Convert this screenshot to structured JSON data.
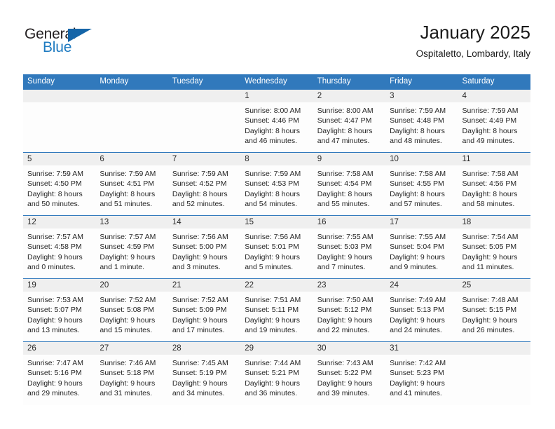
{
  "brand": {
    "name_part1": "General",
    "name_part2": "Blue",
    "accent_color": "#1f7bc1",
    "triangle_color": "#1565a8"
  },
  "header": {
    "title": "January 2025",
    "location": "Ospitaletto, Lombardy, Italy"
  },
  "theme": {
    "header_bg": "#3179bc",
    "daynum_bg": "#efefef",
    "row_border": "#3179bc"
  },
  "weekdays": [
    "Sunday",
    "Monday",
    "Tuesday",
    "Wednesday",
    "Thursday",
    "Friday",
    "Saturday"
  ],
  "weeks": [
    [
      {
        "day": "",
        "l1": "",
        "l2": "",
        "l3": "",
        "l4": ""
      },
      {
        "day": "",
        "l1": "",
        "l2": "",
        "l3": "",
        "l4": ""
      },
      {
        "day": "",
        "l1": "",
        "l2": "",
        "l3": "",
        "l4": ""
      },
      {
        "day": "1",
        "l1": "Sunrise: 8:00 AM",
        "l2": "Sunset: 4:46 PM",
        "l3": "Daylight: 8 hours",
        "l4": "and 46 minutes."
      },
      {
        "day": "2",
        "l1": "Sunrise: 8:00 AM",
        "l2": "Sunset: 4:47 PM",
        "l3": "Daylight: 8 hours",
        "l4": "and 47 minutes."
      },
      {
        "day": "3",
        "l1": "Sunrise: 7:59 AM",
        "l2": "Sunset: 4:48 PM",
        "l3": "Daylight: 8 hours",
        "l4": "and 48 minutes."
      },
      {
        "day": "4",
        "l1": "Sunrise: 7:59 AM",
        "l2": "Sunset: 4:49 PM",
        "l3": "Daylight: 8 hours",
        "l4": "and 49 minutes."
      }
    ],
    [
      {
        "day": "5",
        "l1": "Sunrise: 7:59 AM",
        "l2": "Sunset: 4:50 PM",
        "l3": "Daylight: 8 hours",
        "l4": "and 50 minutes."
      },
      {
        "day": "6",
        "l1": "Sunrise: 7:59 AM",
        "l2": "Sunset: 4:51 PM",
        "l3": "Daylight: 8 hours",
        "l4": "and 51 minutes."
      },
      {
        "day": "7",
        "l1": "Sunrise: 7:59 AM",
        "l2": "Sunset: 4:52 PM",
        "l3": "Daylight: 8 hours",
        "l4": "and 52 minutes."
      },
      {
        "day": "8",
        "l1": "Sunrise: 7:59 AM",
        "l2": "Sunset: 4:53 PM",
        "l3": "Daylight: 8 hours",
        "l4": "and 54 minutes."
      },
      {
        "day": "9",
        "l1": "Sunrise: 7:58 AM",
        "l2": "Sunset: 4:54 PM",
        "l3": "Daylight: 8 hours",
        "l4": "and 55 minutes."
      },
      {
        "day": "10",
        "l1": "Sunrise: 7:58 AM",
        "l2": "Sunset: 4:55 PM",
        "l3": "Daylight: 8 hours",
        "l4": "and 57 minutes."
      },
      {
        "day": "11",
        "l1": "Sunrise: 7:58 AM",
        "l2": "Sunset: 4:56 PM",
        "l3": "Daylight: 8 hours",
        "l4": "and 58 minutes."
      }
    ],
    [
      {
        "day": "12",
        "l1": "Sunrise: 7:57 AM",
        "l2": "Sunset: 4:58 PM",
        "l3": "Daylight: 9 hours",
        "l4": "and 0 minutes."
      },
      {
        "day": "13",
        "l1": "Sunrise: 7:57 AM",
        "l2": "Sunset: 4:59 PM",
        "l3": "Daylight: 9 hours",
        "l4": "and 1 minute."
      },
      {
        "day": "14",
        "l1": "Sunrise: 7:56 AM",
        "l2": "Sunset: 5:00 PM",
        "l3": "Daylight: 9 hours",
        "l4": "and 3 minutes."
      },
      {
        "day": "15",
        "l1": "Sunrise: 7:56 AM",
        "l2": "Sunset: 5:01 PM",
        "l3": "Daylight: 9 hours",
        "l4": "and 5 minutes."
      },
      {
        "day": "16",
        "l1": "Sunrise: 7:55 AM",
        "l2": "Sunset: 5:03 PM",
        "l3": "Daylight: 9 hours",
        "l4": "and 7 minutes."
      },
      {
        "day": "17",
        "l1": "Sunrise: 7:55 AM",
        "l2": "Sunset: 5:04 PM",
        "l3": "Daylight: 9 hours",
        "l4": "and 9 minutes."
      },
      {
        "day": "18",
        "l1": "Sunrise: 7:54 AM",
        "l2": "Sunset: 5:05 PM",
        "l3": "Daylight: 9 hours",
        "l4": "and 11 minutes."
      }
    ],
    [
      {
        "day": "19",
        "l1": "Sunrise: 7:53 AM",
        "l2": "Sunset: 5:07 PM",
        "l3": "Daylight: 9 hours",
        "l4": "and 13 minutes."
      },
      {
        "day": "20",
        "l1": "Sunrise: 7:52 AM",
        "l2": "Sunset: 5:08 PM",
        "l3": "Daylight: 9 hours",
        "l4": "and 15 minutes."
      },
      {
        "day": "21",
        "l1": "Sunrise: 7:52 AM",
        "l2": "Sunset: 5:09 PM",
        "l3": "Daylight: 9 hours",
        "l4": "and 17 minutes."
      },
      {
        "day": "22",
        "l1": "Sunrise: 7:51 AM",
        "l2": "Sunset: 5:11 PM",
        "l3": "Daylight: 9 hours",
        "l4": "and 19 minutes."
      },
      {
        "day": "23",
        "l1": "Sunrise: 7:50 AM",
        "l2": "Sunset: 5:12 PM",
        "l3": "Daylight: 9 hours",
        "l4": "and 22 minutes."
      },
      {
        "day": "24",
        "l1": "Sunrise: 7:49 AM",
        "l2": "Sunset: 5:13 PM",
        "l3": "Daylight: 9 hours",
        "l4": "and 24 minutes."
      },
      {
        "day": "25",
        "l1": "Sunrise: 7:48 AM",
        "l2": "Sunset: 5:15 PM",
        "l3": "Daylight: 9 hours",
        "l4": "and 26 minutes."
      }
    ],
    [
      {
        "day": "26",
        "l1": "Sunrise: 7:47 AM",
        "l2": "Sunset: 5:16 PM",
        "l3": "Daylight: 9 hours",
        "l4": "and 29 minutes."
      },
      {
        "day": "27",
        "l1": "Sunrise: 7:46 AM",
        "l2": "Sunset: 5:18 PM",
        "l3": "Daylight: 9 hours",
        "l4": "and 31 minutes."
      },
      {
        "day": "28",
        "l1": "Sunrise: 7:45 AM",
        "l2": "Sunset: 5:19 PM",
        "l3": "Daylight: 9 hours",
        "l4": "and 34 minutes."
      },
      {
        "day": "29",
        "l1": "Sunrise: 7:44 AM",
        "l2": "Sunset: 5:21 PM",
        "l3": "Daylight: 9 hours",
        "l4": "and 36 minutes."
      },
      {
        "day": "30",
        "l1": "Sunrise: 7:43 AM",
        "l2": "Sunset: 5:22 PM",
        "l3": "Daylight: 9 hours",
        "l4": "and 39 minutes."
      },
      {
        "day": "31",
        "l1": "Sunrise: 7:42 AM",
        "l2": "Sunset: 5:23 PM",
        "l3": "Daylight: 9 hours",
        "l4": "and 41 minutes."
      },
      {
        "day": "",
        "l1": "",
        "l2": "",
        "l3": "",
        "l4": ""
      }
    ]
  ]
}
